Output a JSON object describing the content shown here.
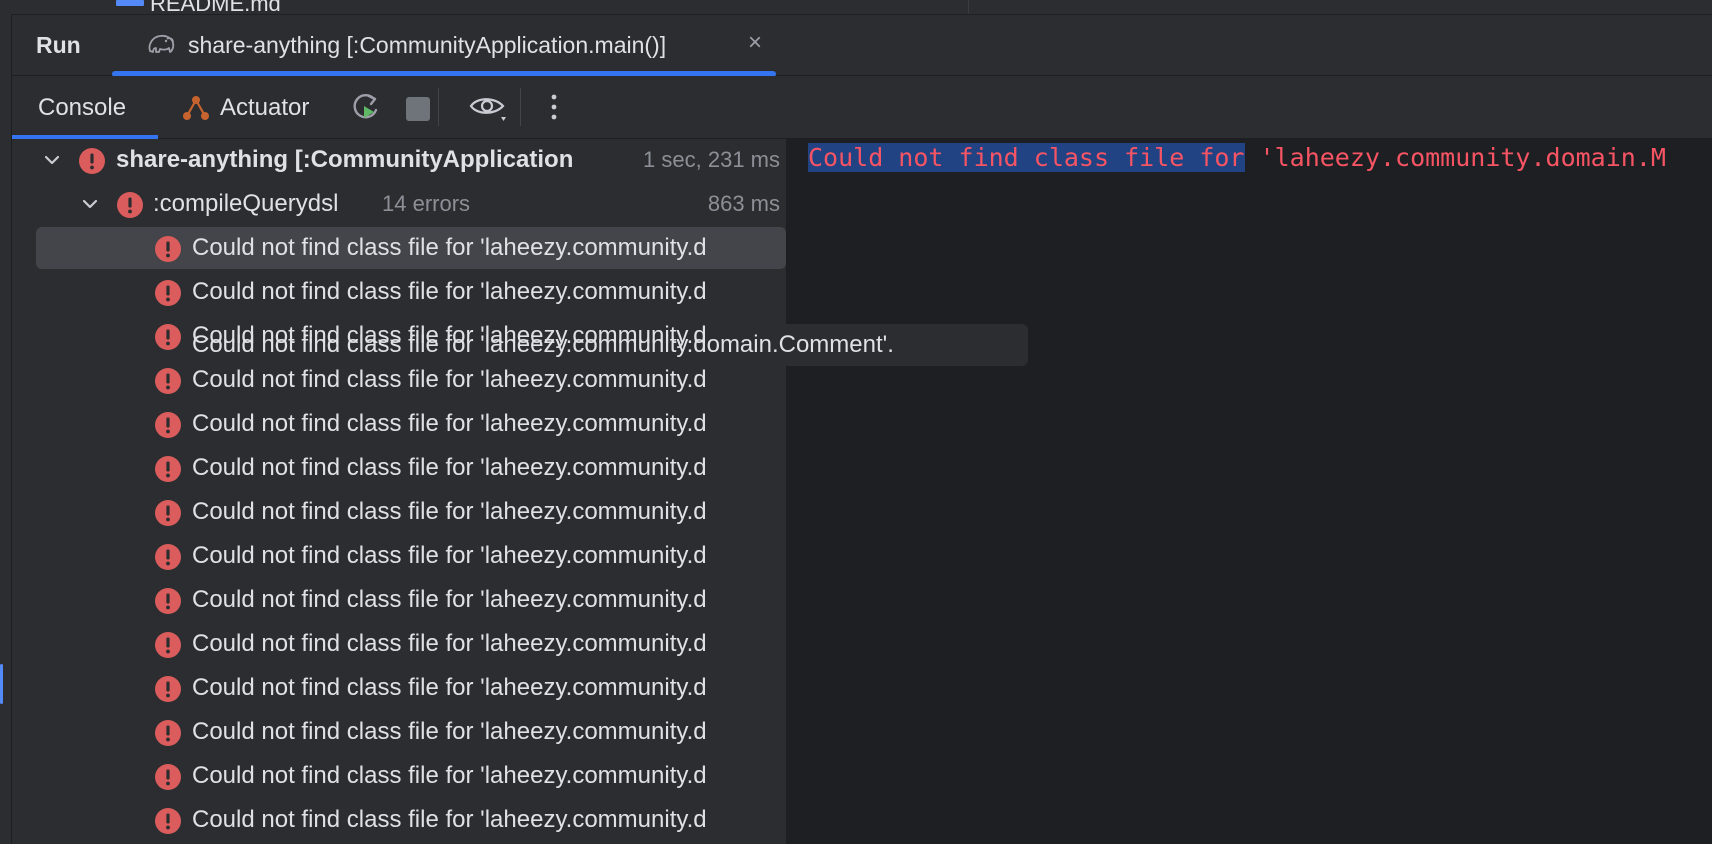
{
  "topstrip": {
    "file_name": "README.md"
  },
  "run_panel": {
    "label": "Run",
    "tab": {
      "title": "share-anything [:CommunityApplication.main()]",
      "close": "×"
    }
  },
  "toolbar": {
    "console_label": "Console",
    "actuator_label": "Actuator"
  },
  "tree": {
    "root": {
      "label": "share-anything [:CommunityApplication",
      "time": "1 sec, 231 ms"
    },
    "task": {
      "label": ":compileQuerydsl",
      "meta": "14 errors",
      "time": "863 ms"
    },
    "errors": [
      "Could not find class file for 'laheezy.community.d",
      "Could not find class file for 'laheezy.community.d",
      "Could not find class file for 'laheezy.community.d",
      "Could not find class file for 'laheezy.community.d",
      "Could not find class file for 'laheezy.community.d",
      "Could not find class file for 'laheezy.community.d",
      "Could not find class file for 'laheezy.community.d",
      "Could not find class file for 'laheezy.community.d",
      "Could not find class file for 'laheezy.community.d",
      "Could not find class file for 'laheezy.community.d",
      "Could not find class file for 'laheezy.community.d",
      "Could not find class file for 'laheezy.community.d",
      "Could not find class file for 'laheezy.community.d",
      "Could not find class file for 'laheezy.community.d"
    ],
    "tooltip": "Could not find class file for 'laheezy.community.domain.Comment'."
  },
  "console": {
    "selected_text": "Could not find class file for",
    "rest_text": " 'laheezy.community.domain.M"
  },
  "colors": {
    "accent": "#3574f0",
    "error": "#db5c5c",
    "console_error": "#f75464",
    "selection": "#214283"
  }
}
